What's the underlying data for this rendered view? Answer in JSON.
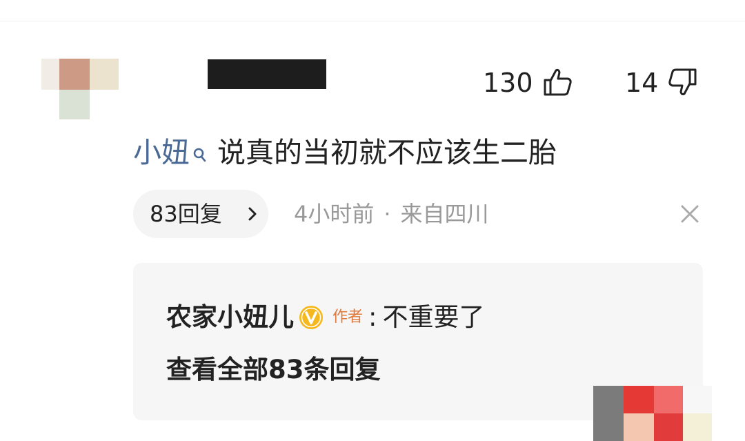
{
  "comment": {
    "like_count": "130",
    "dislike_count": "14",
    "username": "小妞",
    "text": "说真的当初就不应该生二胎",
    "reply_chip_label": "83回复",
    "time": "4小时前",
    "meta_separator": "·",
    "location": "来自四川"
  },
  "reply": {
    "author": "农家小妞儿",
    "author_badge": "作者",
    "separator": ":",
    "text": "不重要了",
    "view_all_label": "查看全部83条回复"
  },
  "icons": {
    "like": "thumbs-up-icon",
    "dislike": "thumbs-down-icon",
    "close": "close-icon",
    "chevron": "chevron-right-icon",
    "verified": "verified-v-icon"
  },
  "colors": {
    "username": "#4a6a95",
    "meta": "#999999",
    "author_badge": "#e07a3c",
    "verified": "#f5b91f",
    "reply_box": "#f6f6f6"
  }
}
